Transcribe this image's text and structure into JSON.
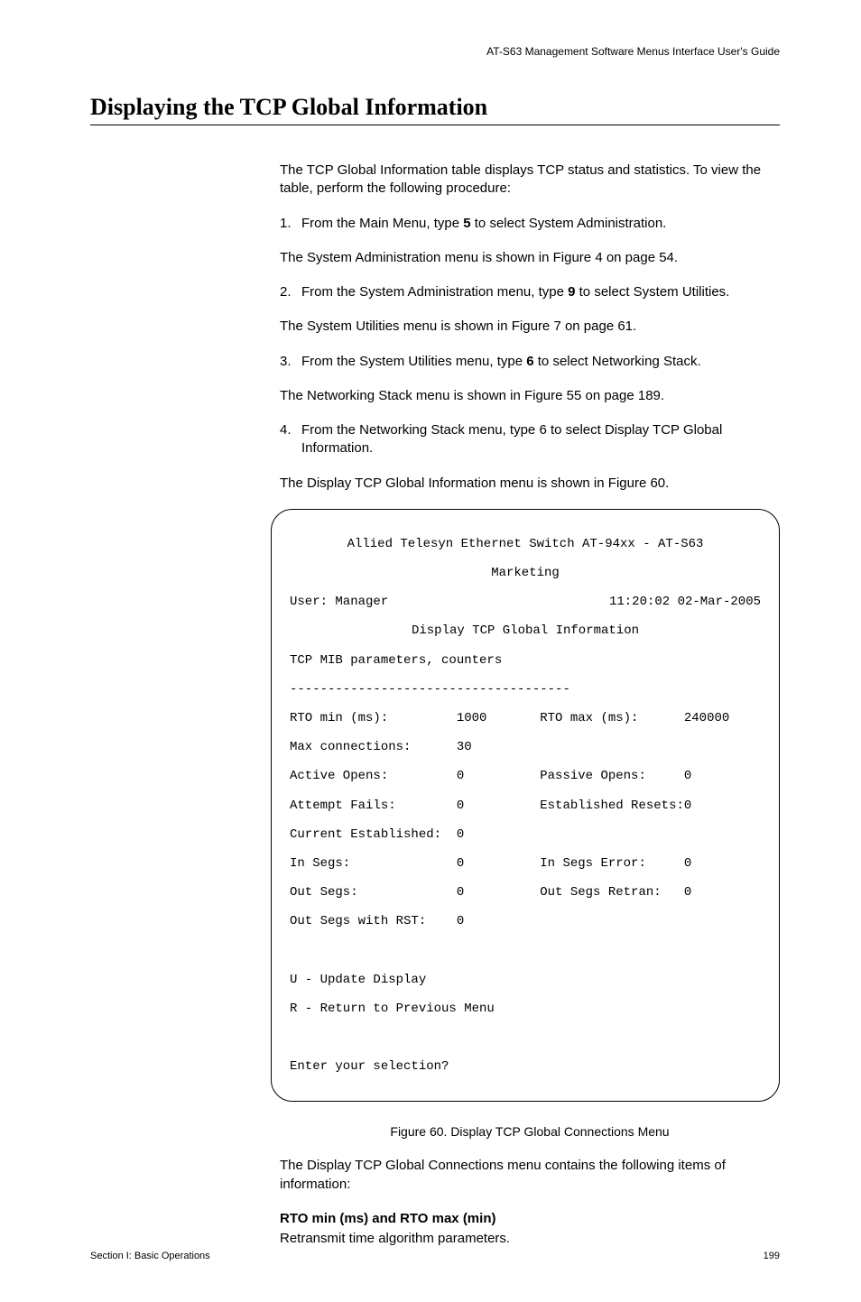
{
  "runningHead": "AT-S63 Management Software Menus Interface User's Guide",
  "title": "Displaying the TCP Global Information",
  "intro": "The TCP Global Information table displays TCP status and statistics. To view the table, perform the following procedure:",
  "steps": [
    {
      "num": "1.",
      "pre": "From the Main Menu, type ",
      "bold": "5",
      "post": " to select System Administration.",
      "follow": "The System Administration menu is shown in Figure 4 on page 54."
    },
    {
      "num": "2.",
      "pre": "From the System Administration menu, type ",
      "bold": "9",
      "post": " to select System Utilities.",
      "follow": "The System Utilities menu is shown in Figure 7 on page 61."
    },
    {
      "num": "3.",
      "pre": "From the System Utilities menu, type ",
      "bold": "6",
      "post": " to select Networking Stack.",
      "follow": "The Networking Stack menu is shown in Figure 55 on page 189."
    },
    {
      "num": "4.",
      "pre": "From the Networking Stack menu, type 6 to select Display TCP Global Information.",
      "bold": "",
      "post": "",
      "follow": "The Display TCP Global Information menu is shown in Figure 60."
    }
  ],
  "terminal": {
    "line1": "Allied Telesyn Ethernet Switch AT-94xx - AT-S63",
    "line2": "Marketing",
    "userLabel": "User: Manager",
    "datetime": "11:20:02 02-Mar-2005",
    "menuTitle": "Display TCP Global Information",
    "mibHeader": "TCP MIB parameters, counters",
    "divider": "-------------------------------------",
    "rows": [
      "RTO min (ms):         1000       RTO max (ms):      240000",
      "Max connections:      30",
      "Active Opens:         0          Passive Opens:     0",
      "Attempt Fails:        0          Established Resets:0",
      "Current Established:  0",
      "In Segs:              0          In Segs Error:     0",
      "Out Segs:             0          Out Segs Retran:   0",
      "Out Segs with RST:    0"
    ],
    "optU": "U - Update Display",
    "optR": "R - Return to Previous Menu",
    "prompt": "Enter your selection?"
  },
  "figCaption": "Figure 60. Display TCP Global Connections Menu",
  "afterFig": "The Display TCP Global Connections menu contains the following items of information:",
  "defTerm": "RTO min (ms) and RTO max (min)",
  "defDesc": "Retransmit time algorithm parameters.",
  "footerLeft": "Section I: Basic Operations",
  "footerRight": "199"
}
